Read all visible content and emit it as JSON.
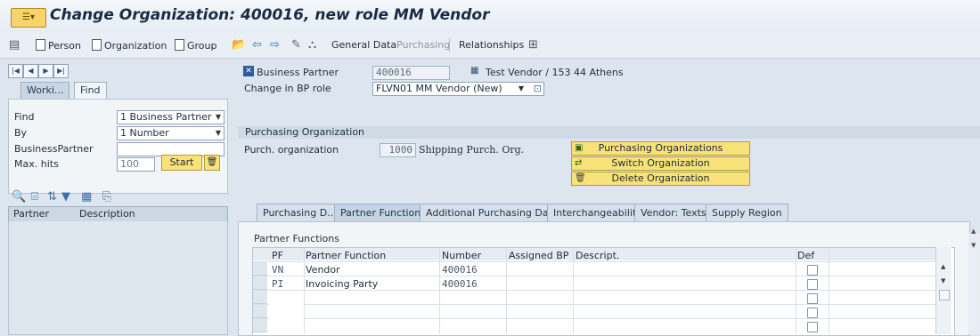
{
  "window": {
    "title": "Change Organization: 400016, new role MM Vendor",
    "app_icon": "sap-icon"
  },
  "toolbar": {
    "person": "Person",
    "organization": "Organization",
    "group": "Group",
    "general_data": "General Data",
    "purchasing": "Purchasing",
    "relationships": "Relationships"
  },
  "left": {
    "tabs": [
      "Worki...",
      "Find"
    ],
    "find": {
      "find_label": "Find",
      "find_value": "1 Business Partner",
      "by_label": "By",
      "by_value": "1 Number",
      "bp_label": "BusinessPartner",
      "bp_value": "",
      "maxhits_label": "Max. hits",
      "maxhits_value": "100",
      "start": "Start"
    },
    "result_columns": [
      "Partner",
      "Description"
    ]
  },
  "header": {
    "bp_label": "Business Partner",
    "bp_value": "400016",
    "bp_desc": "Test Vendor / 153 44 Athens",
    "role_label": "Change in BP role",
    "role_value": "FLVN01 MM Vendor (New)"
  },
  "purchasing_org": {
    "section_title": "Purchasing Organization",
    "label": "Purch. organization",
    "value": "1000",
    "desc": "Shipping Purch. Org.",
    "buttons": [
      "Purchasing Organizations",
      "Switch Organization",
      "Delete Organization"
    ]
  },
  "tabs": [
    "Purchasing D...",
    "Partner Functions",
    "Additional Purchasing Data",
    "Interchangeability",
    "Vendor: Texts",
    "Supply Region"
  ],
  "active_tab": "Partner Functions",
  "partner_functions": {
    "title": "Partner Functions",
    "columns": [
      "PF",
      "Partner Function",
      "Number",
      "Assigned BP",
      "Descript.",
      "Def"
    ],
    "rows": [
      {
        "pf": "VN",
        "function": "Vendor",
        "number": "400016",
        "assigned_bp": "",
        "descript": "",
        "def": false
      },
      {
        "pf": "PI",
        "function": "Invoicing Party",
        "number": "400016",
        "assigned_bp": "",
        "descript": "",
        "def": false
      }
    ]
  },
  "colors": {
    "button_yellow": "#f8e27a",
    "header_blue": "#cfdae5",
    "background": "#dde6ee"
  }
}
